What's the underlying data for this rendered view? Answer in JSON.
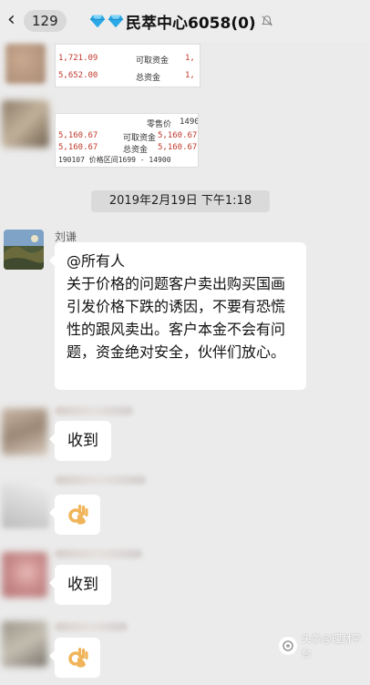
{
  "header": {
    "unread_count": "129",
    "title": "民萃中心6058(0)"
  },
  "screenshot1": {
    "rows": [
      {
        "value": "1,721.09",
        "label": "可取资金",
        "tail": "1,"
      },
      {
        "value": "5,652.00",
        "label": "总资金",
        "tail": "1,"
      }
    ]
  },
  "screenshot2": {
    "rows": [
      {
        "value": "",
        "label": "零售价",
        "tail": "1490"
      },
      {
        "value": "5,160.67",
        "label": "可取资金",
        "tail": "5,160.67"
      },
      {
        "value": "5,160.67",
        "label": "总资金",
        "tail": "5,160.67"
      }
    ],
    "footer": "190107  价格区间1699 - 14900"
  },
  "timestamp": "2019年2月19日 下午1:18",
  "messages": {
    "announcement": {
      "sender": "刘谦",
      "text": "@所有人\n关于价格的问题客户卖出购买国画引发价格下跌的诱因，不要有恐慌性的跟风卖出。客户本金不会有问题，资金绝对安全，伙伴们放心。"
    },
    "reply1": "收到",
    "reply2": "👌",
    "reply3": "收到",
    "reply4": "👌"
  },
  "watermark": "头条@理财平台",
  "colors": {
    "background": "#ebebeb",
    "bubble": "#ffffff",
    "gem": "#2aa8e8"
  }
}
